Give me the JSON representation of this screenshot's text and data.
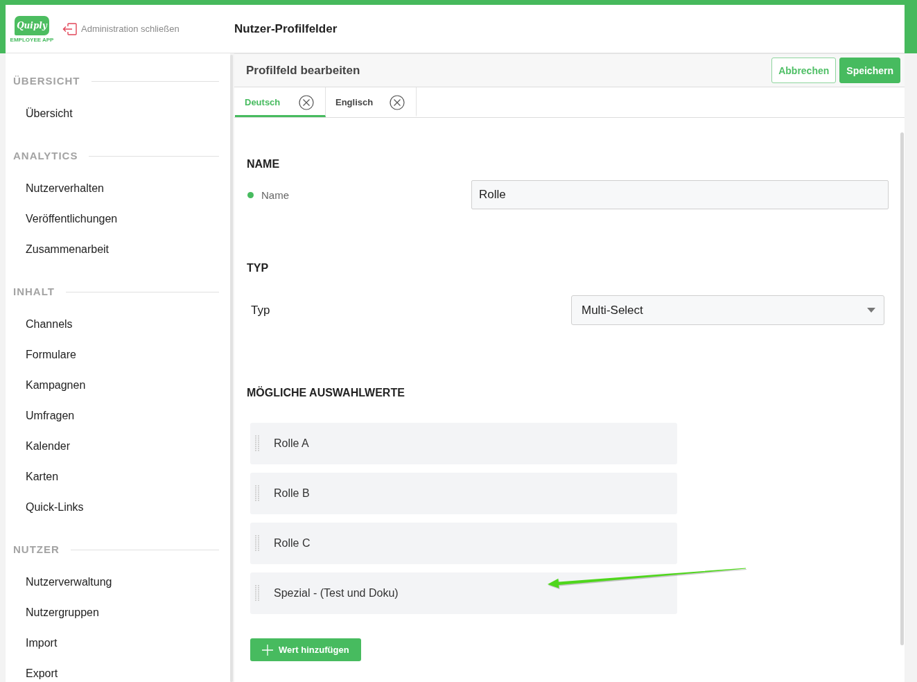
{
  "header": {
    "logo": {
      "wordmark": "Quiply",
      "tagline": "EMPLOYEE APP"
    },
    "close_link": "Administration schließen",
    "title": "Nutzer-Profilfelder"
  },
  "sidebar": {
    "sections": [
      {
        "heading": "ÜBERSICHT",
        "items": [
          {
            "label": "Übersicht",
            "selected": false
          }
        ]
      },
      {
        "heading": "ANALYTICS",
        "items": [
          {
            "label": "Nutzerverhalten",
            "selected": false
          },
          {
            "label": "Veröffentlichungen",
            "selected": false
          },
          {
            "label": "Zusammenarbeit",
            "selected": false
          }
        ]
      },
      {
        "heading": "INHALT",
        "items": [
          {
            "label": "Channels",
            "selected": false
          },
          {
            "label": "Formulare",
            "selected": false
          },
          {
            "label": "Kampagnen",
            "selected": false
          },
          {
            "label": "Umfragen",
            "selected": false
          },
          {
            "label": "Kalender",
            "selected": false
          },
          {
            "label": "Karten",
            "selected": false
          },
          {
            "label": "Quick-Links",
            "selected": false
          }
        ]
      },
      {
        "heading": "NUTZER",
        "items": [
          {
            "label": "Nutzerverwaltung",
            "selected": false
          },
          {
            "label": "Nutzergruppen",
            "selected": false
          },
          {
            "label": "Import",
            "selected": false
          },
          {
            "label": "Export",
            "selected": false
          }
        ]
      }
    ]
  },
  "editor": {
    "title": "Profilfeld bearbeiten",
    "buttons": [
      {
        "label": "Abbrechen",
        "kind": "secondary"
      },
      {
        "label": "Speichern",
        "kind": "primary"
      }
    ],
    "tabs": [
      {
        "label": "Deutsch",
        "selected": true
      },
      {
        "label": "Englisch",
        "selected": false
      }
    ],
    "sections": [
      {
        "kind": "text",
        "heading": "NAME",
        "label": "Name",
        "status_dot": true,
        "value": "Rolle"
      },
      {
        "kind": "select",
        "heading": "TYP",
        "label": "Typ",
        "value": "Multi-Select"
      },
      {
        "kind": "list",
        "heading": "MÖGLICHE AUSWAHLWERTE",
        "values": [
          "Rolle A",
          "Rolle B",
          "Rolle C",
          "Spezial - (Test und Doku)"
        ],
        "add_button": "Wert hinzufügen"
      }
    ]
  },
  "annotation": {
    "kind": "arrow"
  }
}
